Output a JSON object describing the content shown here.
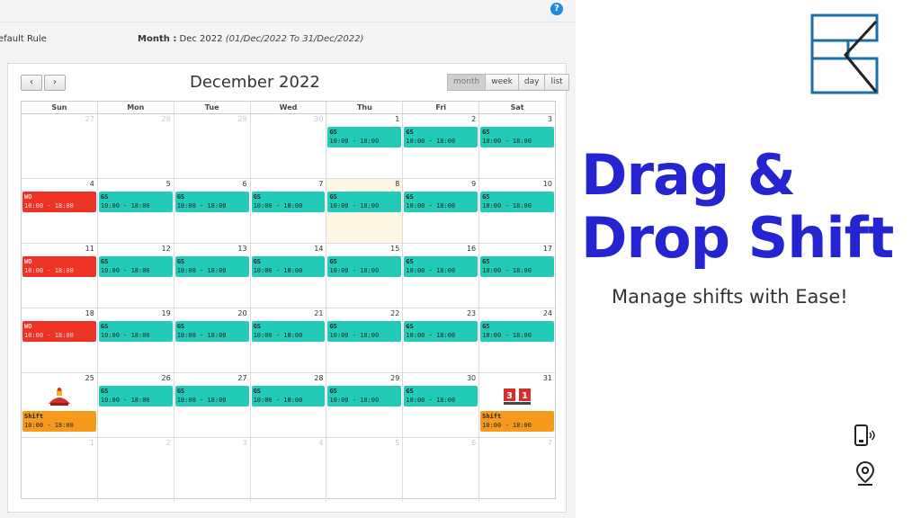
{
  "app": {
    "help_icon": "?",
    "rule_label": "efault Rule",
    "month_label": "Month :",
    "month_value": "Dec 2022",
    "month_range": "(01/Dec/2022  To  31/Dec/2022)"
  },
  "calendar": {
    "title": "December 2022",
    "prev_icon": "‹",
    "next_icon": "›",
    "views": [
      "month",
      "week",
      "day",
      "list"
    ],
    "active_view": "month",
    "weekdays": [
      "Sun",
      "Mon",
      "Tue",
      "Wed",
      "Thu",
      "Fri",
      "Sat"
    ],
    "weeks": [
      [
        {
          "num": "27",
          "other": true
        },
        {
          "num": "28",
          "other": true
        },
        {
          "num": "29",
          "other": true
        },
        {
          "num": "30",
          "other": true
        },
        {
          "num": "1",
          "event": {
            "type": "gs",
            "code": "GS",
            "time": "10:00 - 18:00"
          }
        },
        {
          "num": "2",
          "event": {
            "type": "gs",
            "code": "GS",
            "time": "10:00 - 18:00"
          }
        },
        {
          "num": "3",
          "event": {
            "type": "gs",
            "code": "GS",
            "time": "10:00 - 18:00"
          }
        }
      ],
      [
        {
          "num": "4",
          "event": {
            "type": "wo",
            "code": "WO",
            "time": "10:00 - 18:00"
          }
        },
        {
          "num": "5",
          "event": {
            "type": "gs",
            "code": "GS",
            "time": "10:00 - 18:00"
          }
        },
        {
          "num": "6",
          "event": {
            "type": "gs",
            "code": "GS",
            "time": "10:00 - 18:00"
          }
        },
        {
          "num": "7",
          "event": {
            "type": "gs",
            "code": "GS",
            "time": "10:00 - 18:00"
          }
        },
        {
          "num": "8",
          "today": true,
          "event": {
            "type": "gs",
            "code": "GS",
            "time": "10:00 - 18:00"
          }
        },
        {
          "num": "9",
          "event": {
            "type": "gs",
            "code": "GS",
            "time": "10:00 - 18:00"
          }
        },
        {
          "num": "10",
          "event": {
            "type": "gs",
            "code": "GS",
            "time": "10:00 - 18:00"
          }
        }
      ],
      [
        {
          "num": "11",
          "event": {
            "type": "wo",
            "code": "WO",
            "time": "10:00 - 18:00"
          }
        },
        {
          "num": "12",
          "event": {
            "type": "gs",
            "code": "GS",
            "time": "10:00 - 18:00"
          }
        },
        {
          "num": "13",
          "event": {
            "type": "gs",
            "code": "GS",
            "time": "10:00 - 18:00"
          }
        },
        {
          "num": "14",
          "event": {
            "type": "gs",
            "code": "GS",
            "time": "10:00 - 18:00"
          }
        },
        {
          "num": "15",
          "event": {
            "type": "gs",
            "code": "GS",
            "time": "10:00 - 18:00"
          }
        },
        {
          "num": "16",
          "event": {
            "type": "gs",
            "code": "GS",
            "time": "10:00 - 18:00"
          }
        },
        {
          "num": "17",
          "event": {
            "type": "gs",
            "code": "GS",
            "time": "10:00 - 18:00"
          }
        }
      ],
      [
        {
          "num": "18",
          "event": {
            "type": "wo",
            "code": "WO",
            "time": "10:00 - 18:00"
          }
        },
        {
          "num": "19",
          "event": {
            "type": "gs",
            "code": "GS",
            "time": "10:00 - 18:00"
          }
        },
        {
          "num": "20",
          "event": {
            "type": "gs",
            "code": "GS",
            "time": "10:00 - 18:00"
          }
        },
        {
          "num": "21",
          "event": {
            "type": "gs",
            "code": "GS",
            "time": "10:00 - 18:00"
          }
        },
        {
          "num": "22",
          "event": {
            "type": "gs",
            "code": "GS",
            "time": "10:00 - 18:00"
          }
        },
        {
          "num": "23",
          "event": {
            "type": "gs",
            "code": "GS",
            "time": "10:00 - 18:00"
          }
        },
        {
          "num": "24",
          "event": {
            "type": "gs",
            "code": "GS",
            "time": "10:00 - 18:00"
          }
        }
      ],
      [
        {
          "num": "25",
          "holiday": "christmas-icon",
          "event": {
            "type": "shift",
            "code": "Shift",
            "time": "10:00 - 18:00"
          }
        },
        {
          "num": "26",
          "event": {
            "type": "gs",
            "code": "GS",
            "time": "10:00 - 18:00"
          }
        },
        {
          "num": "27",
          "event": {
            "type": "gs",
            "code": "GS",
            "time": "10:00 - 18:00"
          }
        },
        {
          "num": "28",
          "event": {
            "type": "gs",
            "code": "GS",
            "time": "10:00 - 18:00"
          }
        },
        {
          "num": "29",
          "event": {
            "type": "gs",
            "code": "GS",
            "time": "10:00 - 18:00"
          }
        },
        {
          "num": "30",
          "event": {
            "type": "gs",
            "code": "GS",
            "time": "10:00 - 18:00"
          }
        },
        {
          "num": "31",
          "holiday": "new-year-eve-icon",
          "event": {
            "type": "shift",
            "code": "Shift",
            "time": "10:00 - 18:00"
          }
        }
      ],
      [
        {
          "num": "1",
          "other": true
        },
        {
          "num": "2",
          "other": true
        },
        {
          "num": "3",
          "other": true
        },
        {
          "num": "4",
          "other": true
        },
        {
          "num": "5",
          "other": true
        },
        {
          "num": "6",
          "other": true
        },
        {
          "num": "7",
          "other": true
        }
      ]
    ]
  },
  "promo": {
    "headline_line1": "Drag &",
    "headline_line2": "Drop Shift",
    "tagline": "Manage shifts with Ease!",
    "brand_color": "#2424d0",
    "logo_color": "#1a6fa8",
    "icons": [
      "phone-icon",
      "location-pin-icon"
    ]
  },
  "colors": {
    "gs": "#22cbb8",
    "wo": "#ee3324",
    "shift": "#f59a1c",
    "today": "#fcf6e3"
  }
}
